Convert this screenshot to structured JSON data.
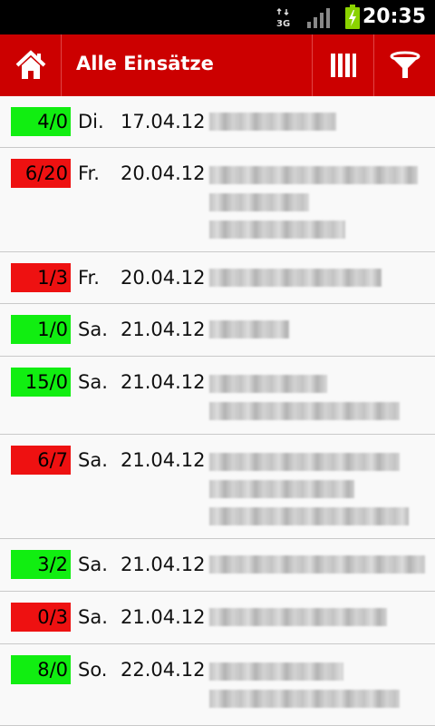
{
  "status_bar": {
    "network": "3G",
    "time": "20:35",
    "icons": [
      "3g-icon",
      "signal-icon",
      "battery-charging-icon"
    ]
  },
  "action_bar": {
    "title": "Alle Einsätze",
    "color": "#cc0000",
    "icons": [
      "home-icon",
      "columns-icon",
      "filter-icon"
    ]
  },
  "colors": {
    "badge_green": "#11ee11",
    "badge_red": "#ee1111"
  },
  "rows": [
    {
      "badge": "4/0",
      "status": "green",
      "day": "Di.",
      "date": "17.04.12"
    },
    {
      "badge": "6/20",
      "status": "red",
      "day": "Fr.",
      "date": "20.04.12"
    },
    {
      "badge": "1/3",
      "status": "red",
      "day": "Fr.",
      "date": "20.04.12"
    },
    {
      "badge": "1/0",
      "status": "green",
      "day": "Sa.",
      "date": "21.04.12"
    },
    {
      "badge": "15/0",
      "status": "green",
      "day": "Sa.",
      "date": "21.04.12"
    },
    {
      "badge": "6/7",
      "status": "red",
      "day": "Sa.",
      "date": "21.04.12"
    },
    {
      "badge": "3/2",
      "status": "green",
      "day": "Sa.",
      "date": "21.04.12"
    },
    {
      "badge": "0/3",
      "status": "red",
      "day": "Sa.",
      "date": "21.04.12"
    },
    {
      "badge": "8/0",
      "status": "green",
      "day": "So.",
      "date": "22.04.12"
    }
  ]
}
